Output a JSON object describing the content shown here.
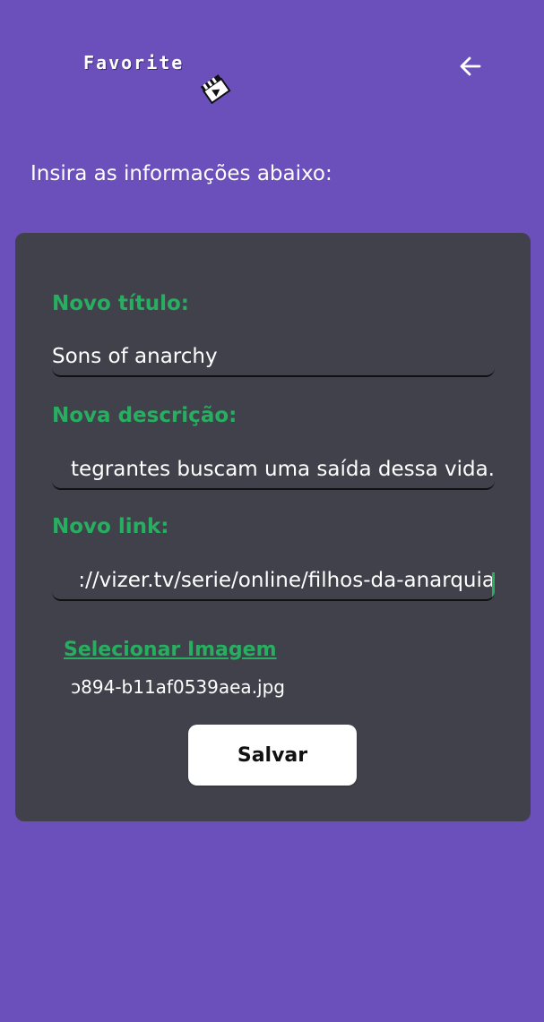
{
  "header": {
    "logo_text": "Favorite",
    "logo_icon": "clapperboard-icon",
    "back_icon": "arrow-left-icon"
  },
  "intro_text": "Insira as informações abaixo:",
  "form": {
    "title_label": "Novo título:",
    "title_value": "Sons of anarchy",
    "description_label": "Nova descrição:",
    "description_value": "tegrantes buscam uma saída dessa vida.",
    "link_label": "Novo link:",
    "link_value": "://vizer.tv/serie/online/filhos-da-anarquia",
    "select_image_label": "Selecionar Imagem",
    "selected_filename": "ɔ894-b11af0539aea.jpg",
    "save_label": "Salvar"
  },
  "colors": {
    "background": "#6b4fbb",
    "card": "#41414b",
    "accent": "#27ae60",
    "text": "#ffffff"
  }
}
